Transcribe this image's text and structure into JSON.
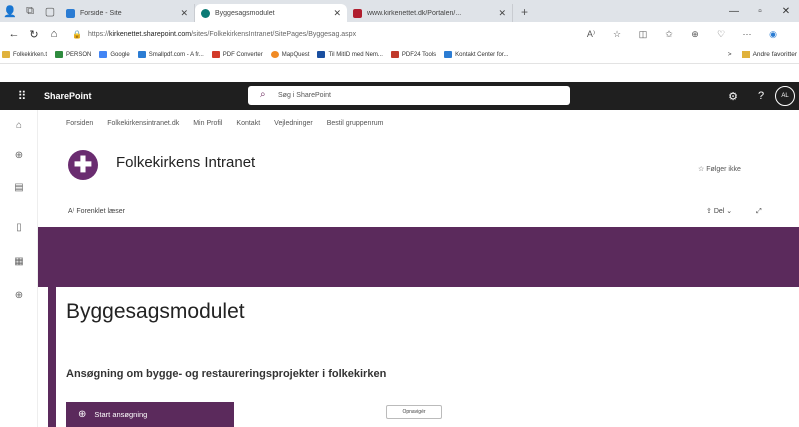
{
  "browser": {
    "tabs": [
      {
        "title": "Forside - Site",
        "color": "#2b7cd3"
      },
      {
        "title": "Byggesagsmodulet",
        "color": "#0b7a75"
      },
      {
        "title": "www.kirkenettet.dk/Portalen/...",
        "color": "#b01e2e"
      }
    ],
    "new_tab": "+",
    "url_prefix": "https://",
    "url_host": "kirkenettet.sharepoint.com",
    "url_path": "/sites/FolkekirkensIntranet/SitePages/Byggesag.aspx",
    "favorites": [
      {
        "label": "Folkekirken.t",
        "color": "#e0b23c"
      },
      {
        "label": "PERSON",
        "color": "#2e8b3e"
      },
      {
        "label": "Google",
        "color": "#4285f4"
      },
      {
        "label": "Smallpdf.com - A fr...",
        "color": "#2b7cd3"
      },
      {
        "label": "PDF Converter",
        "color": "#d23a2a"
      },
      {
        "label": "MapQuest",
        "color": "#f08a24"
      },
      {
        "label": "Til MitID med Nem...",
        "color": "#1a4fa0"
      },
      {
        "label": "PDF24 Tools",
        "color": "#c0392b"
      },
      {
        "label": "Kontakt Center for...",
        "color": "#2b7cd3"
      }
    ],
    "fav_more": ">",
    "other_favorites": "Andre favoritter"
  },
  "suite": {
    "title": "SharePoint",
    "search_placeholder": "Søg i SharePoint",
    "avatar": "AL"
  },
  "hubnav": [
    "Forsiden",
    "Folkekirkensintranet.dk",
    "Min Profil",
    "Kontakt",
    "Vejledninger",
    "Bestil gruppenrum"
  ],
  "site": {
    "logo_glyph": "✚",
    "title": "Folkekirkens Intranet",
    "follow_label": "☆ Følger ikke",
    "immersive_reader": "Forenklet læser",
    "share_label": "Del"
  },
  "page": {
    "title": "Byggesagsmodulet",
    "subtitle": "Ansøgning om bygge- og restaureringsprojekter i folkekirken",
    "start_button": "Start ansøgning",
    "small_button": "Opnavigér"
  },
  "colors": {
    "brand": "#5b2a5c",
    "suitebar": "#1f1f1f"
  }
}
